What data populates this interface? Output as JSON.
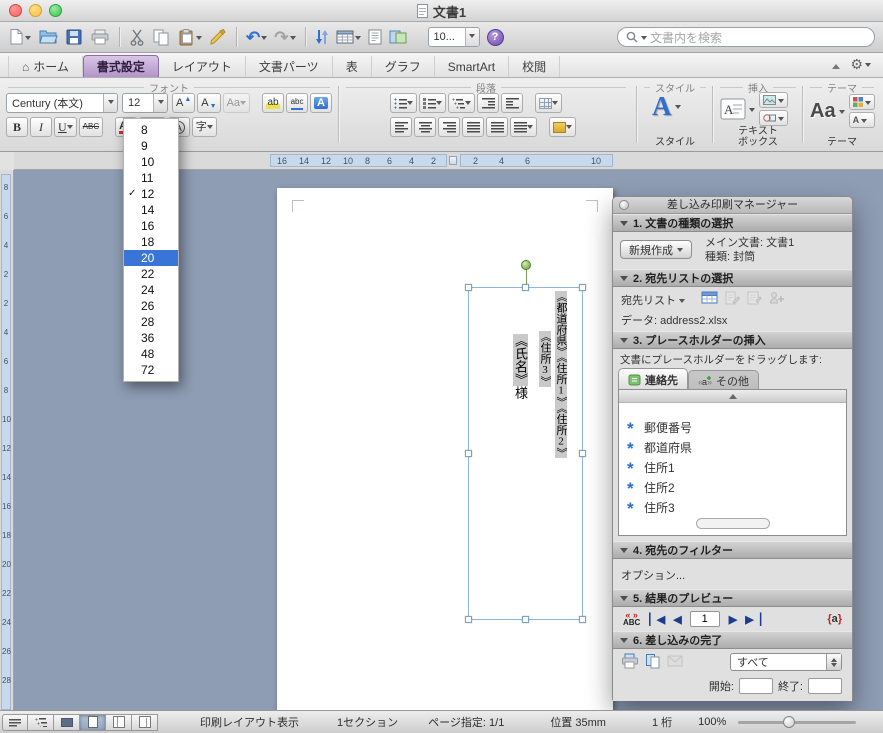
{
  "window": {
    "title": "文書1"
  },
  "toolbar": {
    "zoom_value": "10...",
    "search_placeholder": "文書内を検索",
    "icons": [
      "new-document",
      "open",
      "save",
      "print",
      "cut",
      "copy",
      "paste",
      "format-painter",
      "undo",
      "redo",
      "text-direction",
      "insert-table",
      "columns",
      "show-marks",
      "navigation-pane",
      "zoom",
      "help",
      "search"
    ]
  },
  "tabs": {
    "items": [
      {
        "label": "ホーム",
        "name": "tab-home"
      },
      {
        "label": "書式設定",
        "name": "tab-format"
      },
      {
        "label": "レイアウト",
        "name": "tab-layout"
      },
      {
        "label": "文書パーツ",
        "name": "tab-document-parts"
      },
      {
        "label": "表",
        "name": "tab-tables"
      },
      {
        "label": "グラフ",
        "name": "tab-charts"
      },
      {
        "label": "SmartArt",
        "name": "tab-smartart"
      },
      {
        "label": "校閲",
        "name": "tab-review"
      }
    ],
    "active": "書式設定"
  },
  "ribbon": {
    "group_labels": {
      "font": "フォント",
      "paragraph": "段落",
      "styles": "スタイル",
      "insert": "挿入",
      "themes": "テーマ"
    },
    "font_name": "Century (本文)",
    "font_size": "12",
    "styles_button_label": "スタイル",
    "textbox_label_1": "テキスト",
    "textbox_label_2": "ボックス",
    "themes_button_label": "テーマ",
    "font_buttons_row1": [
      {
        "name": "grow-font",
        "glyph": "A",
        "mark": "▲"
      },
      {
        "name": "shrink-font",
        "glyph": "A",
        "mark": "▼"
      },
      {
        "name": "change-case",
        "glyph": "Aa",
        "dropdown": true,
        "disabled": true
      },
      {
        "name": "highlight",
        "glyph": "ab",
        "style": "hl",
        "gap": true
      },
      {
        "name": "phonetic-guide",
        "glyph": "abc",
        "style": "ub"
      },
      {
        "name": "text-effects",
        "glyph": "A",
        "style": "fx"
      }
    ],
    "font_buttons_row2": [
      {
        "name": "bold",
        "glyph": "B",
        "style": "b"
      },
      {
        "name": "italic",
        "glyph": "I",
        "style": "i"
      },
      {
        "name": "underline",
        "glyph": "U",
        "style": "u",
        "dropdown": true
      },
      {
        "name": "strikethrough",
        "glyph": "ABC",
        "style": "strike"
      },
      {
        "name": "font-color",
        "glyph": "A",
        "style": "fc",
        "dropdown": true,
        "gap": true
      },
      {
        "name": "character-shading",
        "glyph": "A",
        "style": "shade",
        "dropdown": true
      },
      {
        "name": "character-border",
        "glyph": "A",
        "style": "circle"
      },
      {
        "name": "ruby",
        "glyph": "字",
        "dropdown": true
      }
    ],
    "paragraph_buttons_row1": [
      {
        "name": "bullets",
        "icon": "ic-bullets",
        "dropdown": true
      },
      {
        "name": "numbering",
        "icon": "ic-numbers",
        "dropdown": true
      },
      {
        "name": "multilevel-list",
        "icon": "ic-multi",
        "dropdown": true
      },
      {
        "name": "decrease-indent",
        "icon": "ic-outdent"
      },
      {
        "name": "increase-indent",
        "icon": "ic-indent"
      },
      {
        "name": "grid-settings",
        "icon": "ic-grid",
        "dropdown": true,
        "gap": true
      }
    ],
    "paragraph_buttons_row2": [
      {
        "name": "align-left",
        "icon": "ic-al"
      },
      {
        "name": "align-center",
        "icon": "ic-ac"
      },
      {
        "name": "align-right",
        "icon": "ic-ar"
      },
      {
        "name": "justify",
        "icon": "ic-aj"
      },
      {
        "name": "distribute-text",
        "icon": "ic-aj"
      },
      {
        "name": "line-spacing",
        "icon": "ic-ls",
        "dropdown": true
      },
      {
        "name": "shading",
        "icon": "ic-shade",
        "dropdown": true,
        "gap": true
      }
    ]
  },
  "font_size_menu": {
    "items": [
      "8",
      "9",
      "10",
      "11",
      "12",
      "14",
      "16",
      "18",
      "20",
      "22",
      "24",
      "26",
      "28",
      "36",
      "48",
      "72"
    ],
    "checked": "12",
    "selected": "20"
  },
  "rulers": {
    "h_left": [
      "16",
      "14",
      "12",
      "10",
      "8",
      "6",
      "4",
      "2"
    ],
    "h_right": [
      "2",
      "4",
      "6",
      "10"
    ],
    "v": [
      "8",
      "6",
      "4",
      "2",
      "2",
      "4",
      "6",
      "8",
      "10",
      "12",
      "14",
      "16",
      "18",
      "20",
      "22",
      "24",
      "26",
      "28"
    ]
  },
  "document": {
    "line1_fields": [
      "《都道府県》",
      "《住所1》",
      "《住所2》"
    ],
    "line2_fields": [
      "《住所3》"
    ],
    "line3_fields": [
      "《氏名》"
    ],
    "line3_suffix": "様"
  },
  "merge_panel": {
    "title": "差し込み印刷マネージャー",
    "sections": [
      "1. 文書の種類の選択",
      "2. 宛先リストの選択",
      "3. プレースホルダーの挿入",
      "4. 宛先のフィルター",
      "5. 結果のプレビュー",
      "6. 差し込みの完了"
    ],
    "create_new_label": "新規作成",
    "main_doc_label": "メイン文書: 文書1",
    "doc_type_label": "種類: 封筒",
    "recipient_list_label": "宛先リスト",
    "data_source_label": "データ: address2.xlsx",
    "drag_hint": "文書にプレースホルダーをドラッグします:",
    "contacts_tab": "連絡先",
    "more_tab": "その他",
    "placeholders": [
      "郵便番号",
      "都道府県",
      "住所1",
      "住所2",
      "住所3"
    ],
    "filter_options_label": "オプション...",
    "preview_abc": "ABC",
    "preview_quotes": "« »",
    "nav_first": "▏◀",
    "nav_prev": "◀",
    "preview_record": "1",
    "nav_next": "▶",
    "nav_last": "▶▕",
    "highlight_open": "{",
    "highlight_a": "a",
    "highlight_close": "}",
    "merge_to_select": "すべて",
    "range_start_label": "開始:",
    "range_end_label": "終了:"
  },
  "statusbar": {
    "view_mode": "印刷レイアウト表示",
    "sections": "1セクション",
    "page": "ページ指定: 1/1",
    "position": "位置 35mm",
    "column": "1 桁",
    "zoom": "100%"
  },
  "colors": {
    "selection_blue": "#3875d7",
    "active_tab_purple": "#b394c9",
    "field_shading": "#c9c9c9",
    "document_background": "#8e9cb4"
  }
}
